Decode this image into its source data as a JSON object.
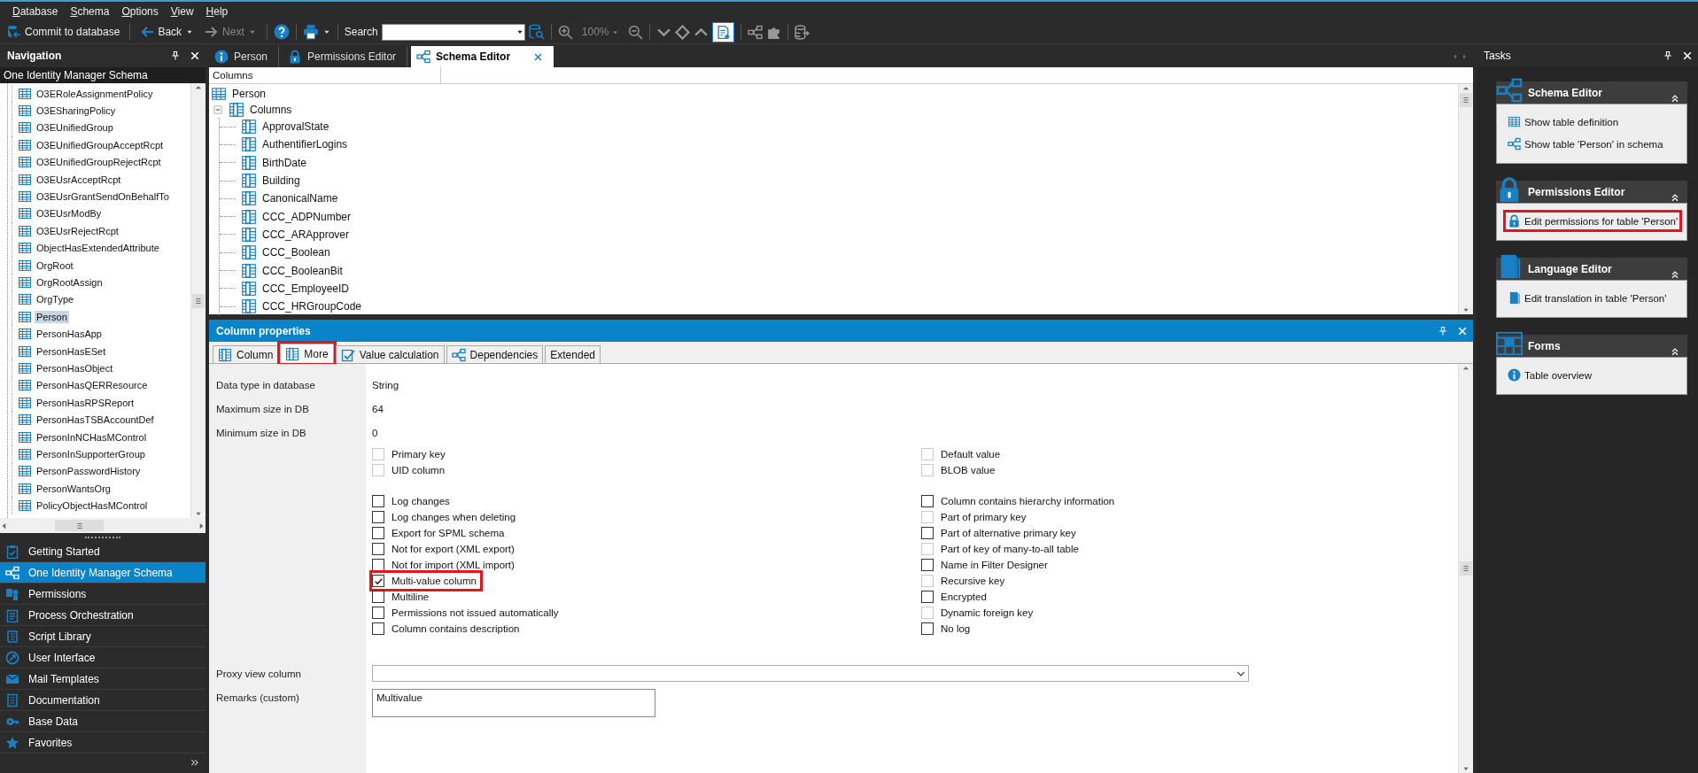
{
  "menu": [
    "Database",
    "Schema",
    "Options",
    "View",
    "Help"
  ],
  "toolbar": {
    "commit_label": "Commit to database",
    "back_label": "Back",
    "next_label": "Next",
    "next_disabled": true,
    "search_label": "Search",
    "zoom_level": "100%",
    "zoom_disabled": true,
    "add_pressed": true
  },
  "navigation": {
    "title": "Navigation",
    "tree_title": "One Identity Manager Schema",
    "items": [
      {
        "label": "O3ERoleAssignmentPolicy",
        "selected": false
      },
      {
        "label": "O3ESharingPolicy",
        "selected": false
      },
      {
        "label": "O3EUnifiedGroup",
        "selected": false
      },
      {
        "label": "O3EUnifiedGroupAcceptRcpt",
        "selected": false
      },
      {
        "label": "O3EUnifiedGroupRejectRcpt",
        "selected": false
      },
      {
        "label": "O3EUsrAcceptRcpt",
        "selected": false
      },
      {
        "label": "O3EUsrGrantSendOnBehalfTo",
        "selected": false
      },
      {
        "label": "O3EUsrModBy",
        "selected": false
      },
      {
        "label": "O3EUsrRejectRcpt",
        "selected": false
      },
      {
        "label": "ObjectHasExtendedAttribute",
        "selected": false
      },
      {
        "label": "OrgRoot",
        "selected": false
      },
      {
        "label": "OrgRootAssign",
        "selected": false
      },
      {
        "label": "OrgType",
        "selected": false
      },
      {
        "label": "Person",
        "selected": true
      },
      {
        "label": "PersonHasApp",
        "selected": false
      },
      {
        "label": "PersonHasESet",
        "selected": false
      },
      {
        "label": "PersonHasObject",
        "selected": false
      },
      {
        "label": "PersonHasQERResource",
        "selected": false
      },
      {
        "label": "PersonHasRPSReport",
        "selected": false
      },
      {
        "label": "PersonHasTSBAccountDef",
        "selected": false
      },
      {
        "label": "PersonInNCHasMControl",
        "selected": false
      },
      {
        "label": "PersonInSupporterGroup",
        "selected": false
      },
      {
        "label": "PersonPasswordHistory",
        "selected": false
      },
      {
        "label": "PersonWantsOrg",
        "selected": false
      },
      {
        "label": "PolicyObjectHasMControl",
        "selected": false
      }
    ],
    "sections": [
      {
        "label": "Getting Started",
        "kind": "checklist",
        "selected": false
      },
      {
        "label": "One Identity Manager Schema",
        "kind": "schema",
        "selected": true
      },
      {
        "label": "Permissions",
        "kind": "permissions",
        "selected": false
      },
      {
        "label": "Process Orchestration",
        "kind": "process",
        "selected": false
      },
      {
        "label": "Script Library",
        "kind": "script",
        "selected": false
      },
      {
        "label": "User Interface",
        "kind": "ui",
        "selected": false
      },
      {
        "label": "Mail Templates",
        "kind": "mail",
        "selected": false
      },
      {
        "label": "Documentation",
        "kind": "docs",
        "selected": false
      },
      {
        "label": "Base Data",
        "kind": "basedata",
        "selected": false
      },
      {
        "label": "Favorites",
        "kind": "star",
        "selected": false
      }
    ]
  },
  "document_tabs": [
    {
      "label": "Person",
      "kind": "info",
      "selected": false,
      "closable": false
    },
    {
      "label": "Permissions Editor",
      "kind": "lock",
      "selected": false,
      "closable": false
    },
    {
      "label": "Schema Editor",
      "kind": "schema",
      "selected": true,
      "closable": true
    }
  ],
  "columns_tree": {
    "header": "Columns",
    "root": "Person",
    "group": {
      "label": "Columns",
      "expanded": true,
      "children": [
        "ApprovalState",
        "AuthentifierLogins",
        "BirthDate",
        "Building",
        "CanonicalName",
        "CCC_ADPNumber",
        "CCC_ARApprover",
        "CCC_Boolean",
        "CCC_BooleanBit",
        "CCC_EmployeeID",
        "CCC_HRGroupCode"
      ]
    }
  },
  "column_properties": {
    "title": "Column properties",
    "tabs": [
      {
        "label": "Column",
        "kind": "column",
        "selected": false,
        "highlighted": false
      },
      {
        "label": "More",
        "kind": "column",
        "selected": true,
        "highlighted": true
      },
      {
        "label": "Value calculation",
        "kind": "calc",
        "selected": false,
        "highlighted": false
      },
      {
        "label": "Dependencies",
        "kind": "schema",
        "selected": false,
        "highlighted": false
      },
      {
        "label": "Extended",
        "kind": "none",
        "selected": false,
        "highlighted": false
      }
    ],
    "fields": [
      {
        "label": "Data type in database",
        "value": "String"
      },
      {
        "label": "Maximum size in DB",
        "value": "64"
      },
      {
        "label": "Minimum size in DB",
        "value": "0"
      }
    ],
    "checkbox_columns": [
      {
        "groups": [
          {
            "items": [
              {
                "label": "Primary key",
                "checked": false,
                "disabled": true,
                "highlighted": false
              },
              {
                "label": "UID column",
                "checked": false,
                "disabled": true,
                "highlighted": false
              }
            ]
          },
          {
            "items": [
              {
                "label": "Log changes",
                "checked": false,
                "disabled": false,
                "highlighted": false
              },
              {
                "label": "Log changes when deleting",
                "checked": false,
                "disabled": false,
                "highlighted": false
              },
              {
                "label": "Export for SPML schema",
                "checked": false,
                "disabled": false,
                "highlighted": false
              },
              {
                "label": "Not for export (XML export)",
                "checked": false,
                "disabled": false,
                "highlighted": false
              },
              {
                "label": "Not for import (XML import)",
                "checked": false,
                "disabled": false,
                "highlighted": false
              },
              {
                "label": "Multi-value column",
                "checked": true,
                "disabled": false,
                "highlighted": true
              },
              {
                "label": "Multiline",
                "checked": false,
                "disabled": false,
                "highlighted": false
              },
              {
                "label": "Permissions not issued automatically",
                "checked": false,
                "disabled": false,
                "highlighted": false
              },
              {
                "label": "Column contains description",
                "checked": false,
                "disabled": false,
                "highlighted": false
              }
            ]
          }
        ]
      },
      {
        "groups": [
          {
            "items": [
              {
                "label": "Default value",
                "checked": false,
                "disabled": true,
                "highlighted": false
              },
              {
                "label": "BLOB value",
                "checked": false,
                "disabled": true,
                "highlighted": false
              }
            ]
          },
          {
            "items": [
              {
                "label": "Column contains hierarchy information",
                "checked": false,
                "disabled": false,
                "highlighted": false
              },
              {
                "label": "Part of primary key",
                "checked": false,
                "disabled": true,
                "highlighted": false
              },
              {
                "label": "Part of alternative primary key",
                "checked": false,
                "disabled": false,
                "highlighted": false
              },
              {
                "label": "Part of key of many-to-all table",
                "checked": false,
                "disabled": true,
                "highlighted": false
              },
              {
                "label": "Name in Filter Designer",
                "checked": false,
                "disabled": false,
                "highlighted": false
              },
              {
                "label": "Recursive key",
                "checked": false,
                "disabled": true,
                "highlighted": false
              },
              {
                "label": "Encrypted",
                "checked": false,
                "disabled": false,
                "highlighted": false
              },
              {
                "label": "Dynamic foreign key",
                "checked": false,
                "disabled": true,
                "highlighted": false
              },
              {
                "label": "No log",
                "checked": false,
                "disabled": false,
                "highlighted": false
              }
            ]
          }
        ]
      }
    ],
    "proxy_view_column": {
      "label": "Proxy view column"
    },
    "remarks": {
      "label": "Remarks (custom)",
      "value": "Multivalue"
    }
  },
  "tasks": {
    "title": "Tasks",
    "groups": [
      {
        "title": "Schema Editor",
        "kind": "schema",
        "items": [
          {
            "label": "Show table definition",
            "kind": "table",
            "highlighted": false
          },
          {
            "label": "Show table 'Person' in schema",
            "kind": "schema",
            "highlighted": false
          }
        ]
      },
      {
        "title": "Permissions Editor",
        "kind": "lock",
        "items": [
          {
            "label": "Edit permissions for table 'Person'",
            "kind": "lock",
            "highlighted": true
          }
        ]
      },
      {
        "title": "Language Editor",
        "kind": "book",
        "items": [
          {
            "label": "Edit translation in table 'Person'",
            "kind": "book",
            "highlighted": false
          }
        ]
      },
      {
        "title": "Forms",
        "kind": "forms",
        "items": [
          {
            "label": "Table overview",
            "kind": "info",
            "highlighted": false
          }
        ]
      }
    ]
  }
}
